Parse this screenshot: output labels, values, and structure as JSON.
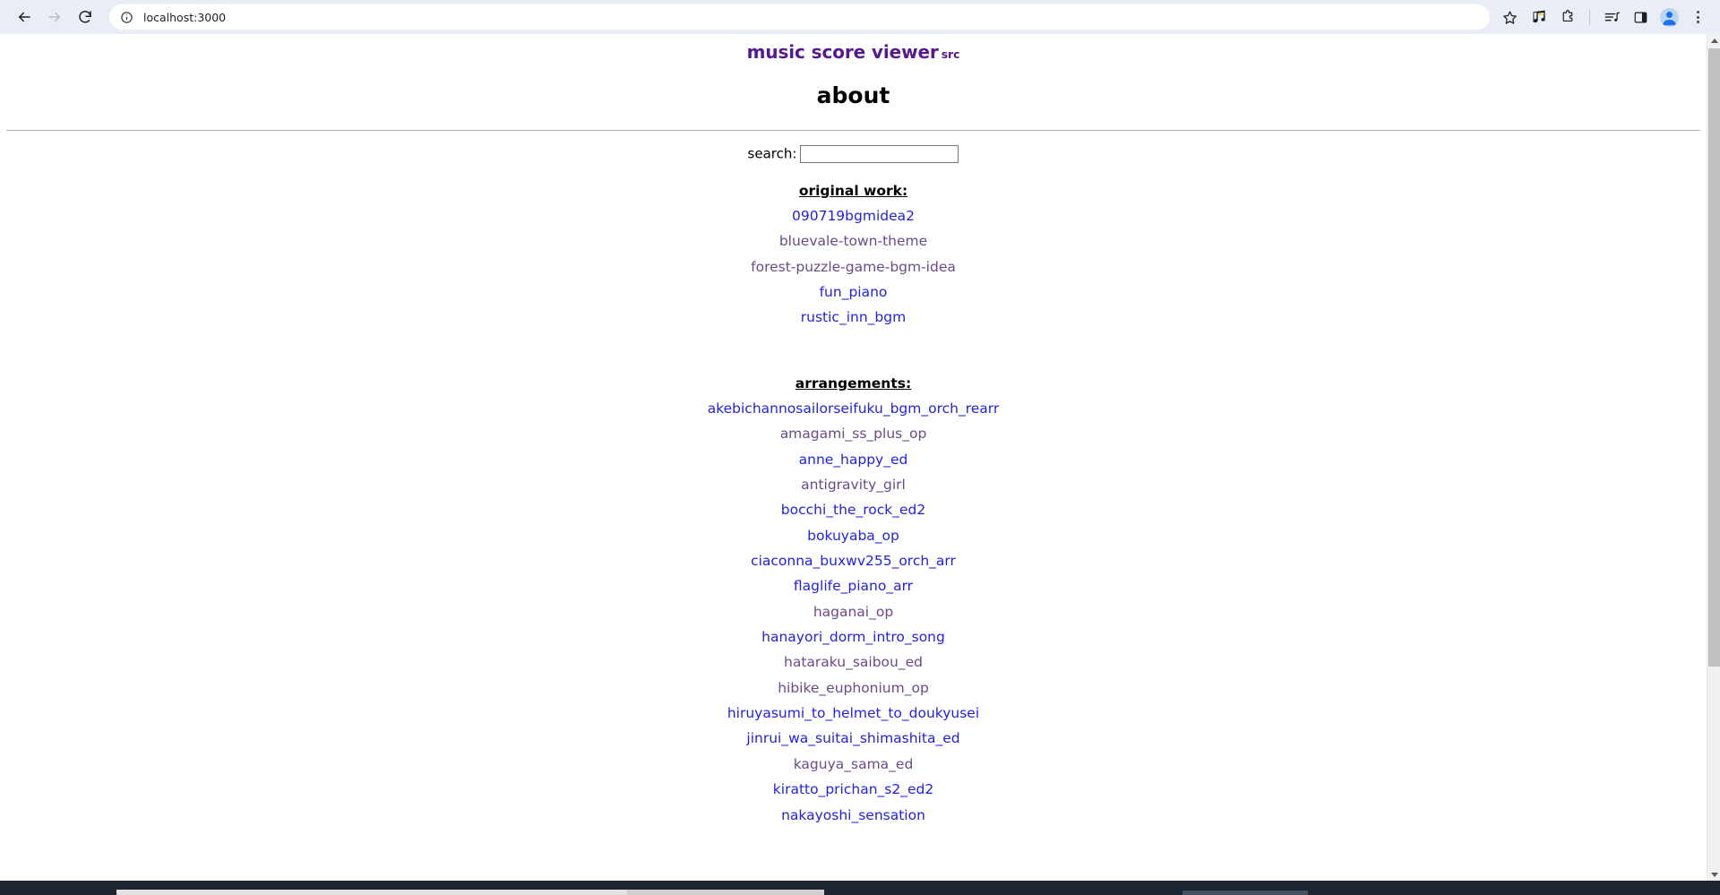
{
  "browser": {
    "url": "localhost:3000",
    "nav": {
      "back": "back-arrow",
      "forward": "forward-arrow",
      "reload": "reload"
    },
    "site_info_icon": "info-circle-icon",
    "actions": [
      {
        "name": "bookmark-star-icon",
        "label": "Bookmark this tab"
      },
      {
        "name": "music-extension-icon",
        "label": "Music extension"
      },
      {
        "name": "extensions-puzzle-icon",
        "label": "Extensions"
      },
      {
        "name": "media-playlist-icon",
        "label": "Media control"
      },
      {
        "name": "side-panel-icon",
        "label": "Side panel"
      },
      {
        "name": "profile-avatar-icon",
        "label": "Profile"
      },
      {
        "name": "chrome-menu-icon",
        "label": "Customize and control"
      }
    ]
  },
  "page": {
    "site_title": "music score viewer",
    "site_title_suffix": "src",
    "heading": "about",
    "search": {
      "label": "search:",
      "value": "",
      "placeholder": ""
    },
    "sections": [
      {
        "heading": "original work:",
        "items": [
          {
            "label": "090719bgmidea2",
            "state": "unvisited"
          },
          {
            "label": "bluevale-town-theme",
            "state": "visited"
          },
          {
            "label": "forest-puzzle-game-bgm-idea",
            "state": "visited"
          },
          {
            "label": "fun_piano",
            "state": "unvisited"
          },
          {
            "label": "rustic_inn_bgm",
            "state": "unvisited"
          }
        ]
      },
      {
        "heading": "arrangements:",
        "items": [
          {
            "label": "akebichannosailorseifuku_bgm_orch_rearr",
            "state": "unvisited"
          },
          {
            "label": "amagami_ss_plus_op",
            "state": "visited"
          },
          {
            "label": "anne_happy_ed",
            "state": "unvisited"
          },
          {
            "label": "antigravity_girl",
            "state": "visited"
          },
          {
            "label": "bocchi_the_rock_ed2",
            "state": "unvisited"
          },
          {
            "label": "bokuyaba_op",
            "state": "unvisited"
          },
          {
            "label": "ciaconna_buxwv255_orch_arr",
            "state": "unvisited"
          },
          {
            "label": "flaglife_piano_arr",
            "state": "unvisited"
          },
          {
            "label": "haganai_op",
            "state": "visited"
          },
          {
            "label": "hanayori_dorm_intro_song",
            "state": "unvisited"
          },
          {
            "label": "hataraku_saibou_ed",
            "state": "visited"
          },
          {
            "label": "hibike_euphonium_op",
            "state": "visited"
          },
          {
            "label": "hiruyasumi_to_helmet_to_doukyusei",
            "state": "unvisited"
          },
          {
            "label": "jinrui_wa_suitai_shimashita_ed",
            "state": "unvisited"
          },
          {
            "label": "kaguya_sama_ed",
            "state": "visited"
          },
          {
            "label": "kiratto_prichan_s2_ed2",
            "state": "unvisited"
          },
          {
            "label": "nakayoshi_sensation",
            "state": "unvisited"
          }
        ]
      }
    ]
  },
  "colors": {
    "link_unvisited": "#2222dd",
    "link_visited": "#6a4a8a",
    "site_title": "#551a8b",
    "chrome_background": "#e9edf6",
    "taskbar": "#1b2430"
  }
}
